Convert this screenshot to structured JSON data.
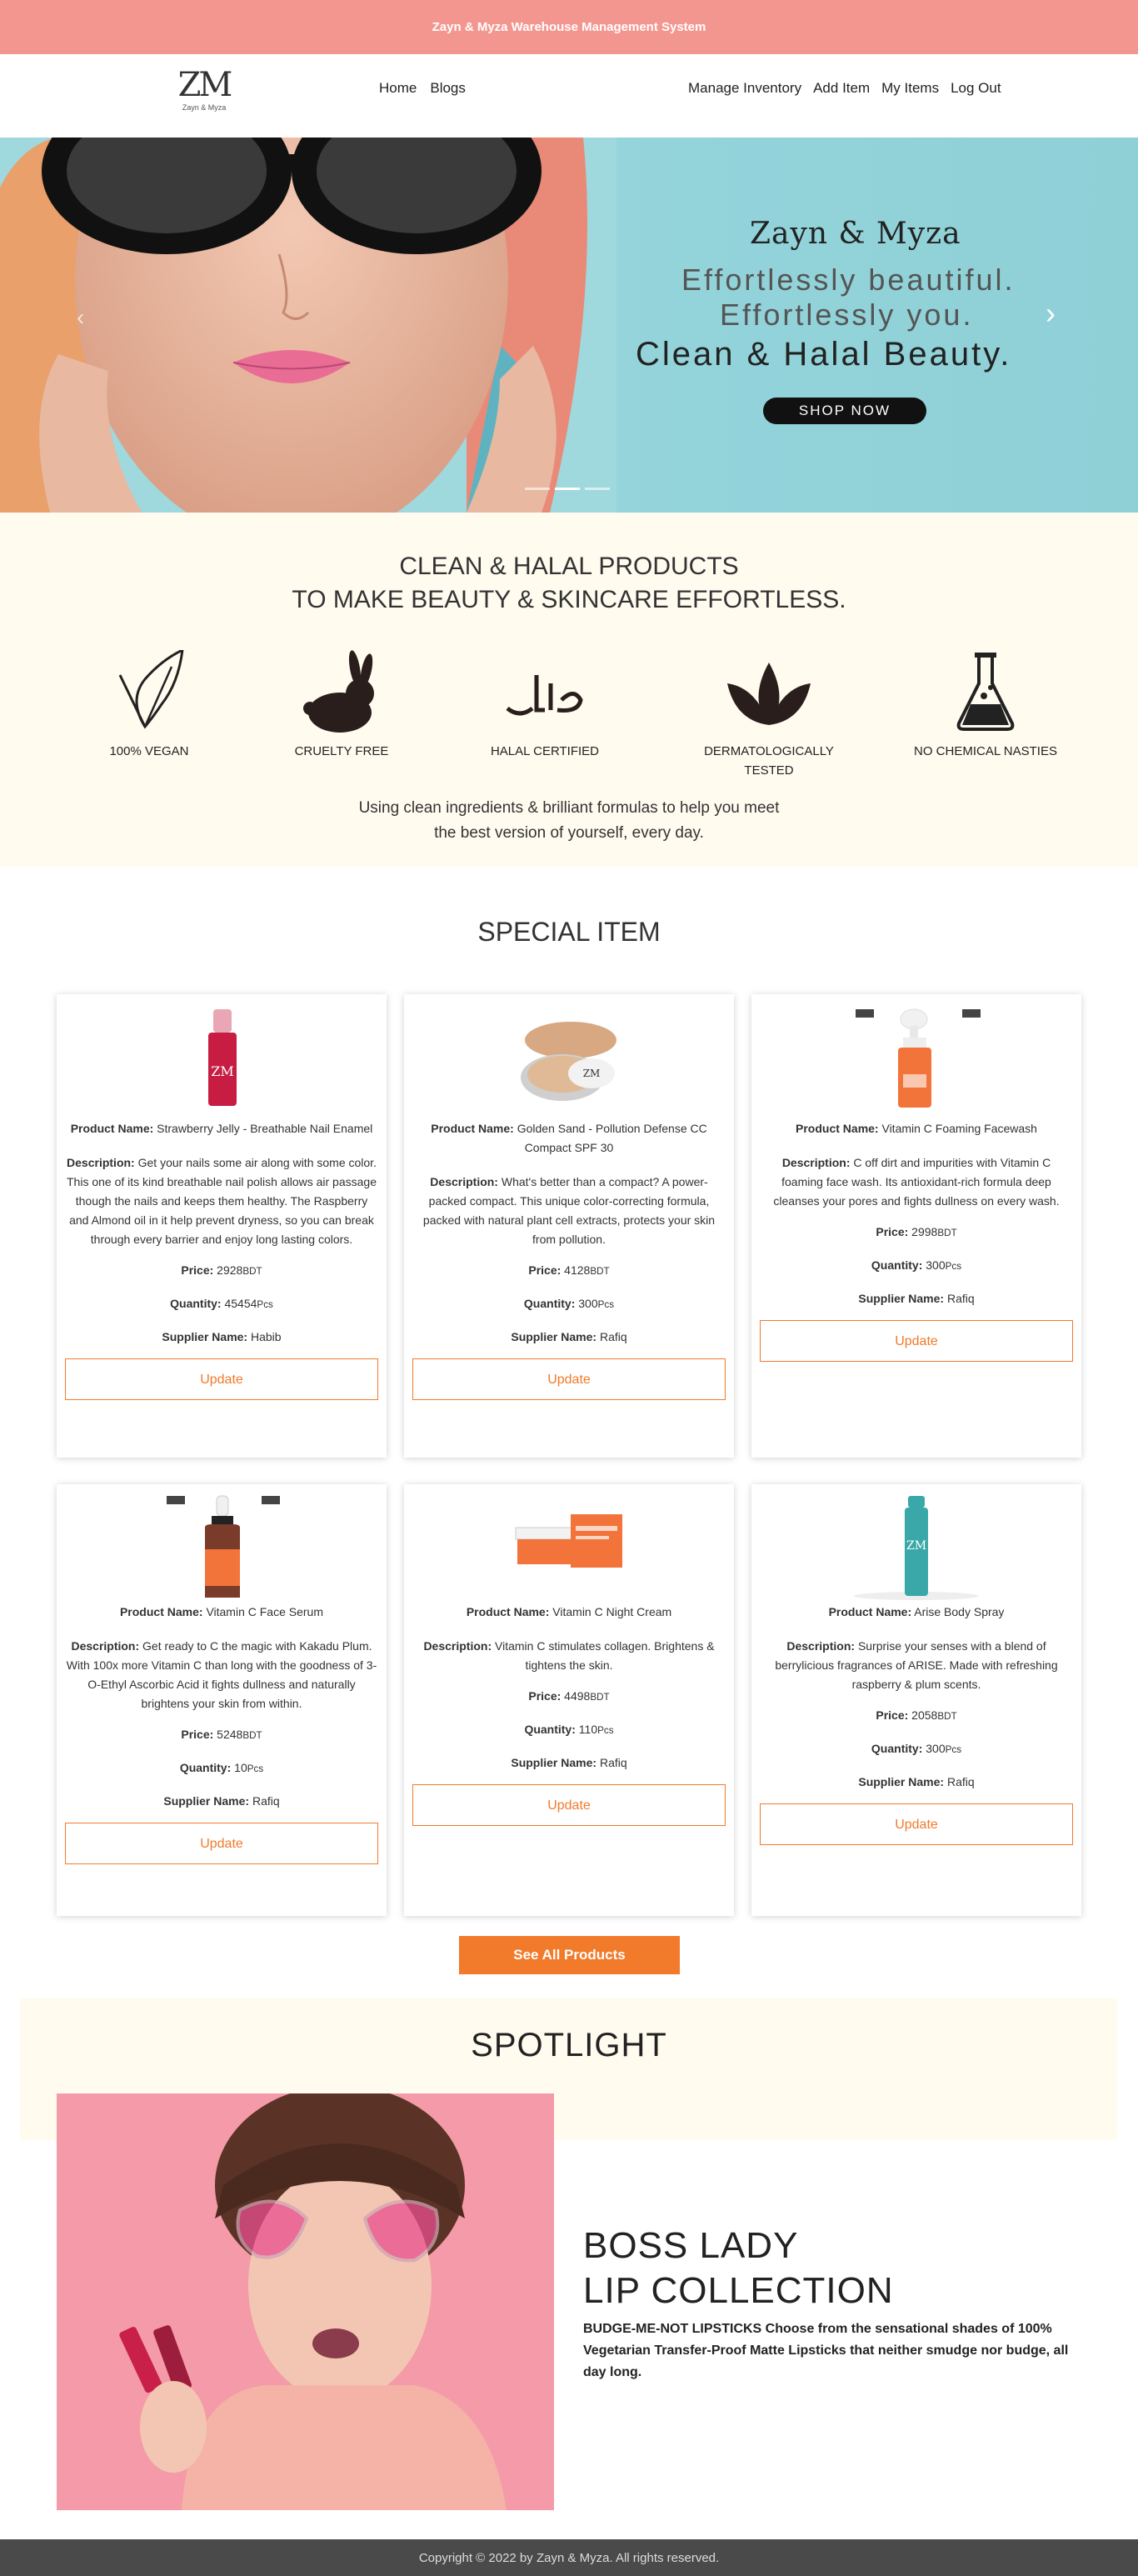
{
  "topbar": {
    "title": "Zayn & Myza Warehouse Management System"
  },
  "logo": {
    "mark": "ZM",
    "sub": "Zayn & Myza"
  },
  "nav": {
    "left": [
      "Home",
      "Blogs"
    ],
    "right": [
      "Manage Inventory",
      "Add Item",
      "My Items",
      "Log Out"
    ]
  },
  "hero": {
    "brand": "Zayn & Myza",
    "line1": "Effortlessly beautiful.",
    "line2": "Effortlessly you.",
    "line3": "Clean & Halal Beauty.",
    "cta": "SHOP NOW",
    "slide_count": 3,
    "active_slide": 2
  },
  "clean": {
    "heading1": "CLEAN & HALAL PRODUCTS",
    "heading2": "TO MAKE BEAUTY & SKINCARE EFFORTLESS.",
    "features": [
      {
        "label": "100% VEGAN",
        "icon": "leaf-icon"
      },
      {
        "label": "CRUELTY FREE",
        "icon": "rabbit-icon"
      },
      {
        "label": "HALAL CERTIFIED",
        "icon": "halal-icon"
      },
      {
        "label": "DERMATOLOGICALLY TESTED",
        "icon": "lotus-icon"
      },
      {
        "label": "NO CHEMICAL NASTIES",
        "icon": "flask-icon"
      }
    ],
    "tagline1": "Using clean ingredients & brilliant formulas to help you meet",
    "tagline2": "the best version of yourself, every day."
  },
  "special": {
    "title": "SPECIAL ITEM"
  },
  "labels": {
    "name": "Product Name:",
    "desc": "Description:",
    "price": "Price:",
    "qty": "Quantity:",
    "supplier": "Supplier Name:",
    "update": "Update",
    "price_unit": "BDT",
    "qty_unit": "Pcs"
  },
  "products": [
    {
      "name": "Strawberry Jelly - Breathable Nail Enamel",
      "description": "Get your nails some air along with some color. This one of its kind breathable nail polish allows air passage though the nails and keeps them healthy. The Raspberry and Almond oil in it help prevent dryness, so you can break through every barrier and enjoy long lasting colors.",
      "price": "2928",
      "quantity": "45454",
      "supplier": "Habib"
    },
    {
      "name": "Golden Sand - Pollution Defense CC Compact SPF 30",
      "description": "What's better than a compact? A power-packed compact. This unique color-correcting formula, packed with natural plant cell extracts, protects your skin from pollution.",
      "price": "4128",
      "quantity": "300",
      "supplier": "Rafiq"
    },
    {
      "name": "Vitamin C Foaming Facewash",
      "description": "C off dirt and impurities with Vitamin C foaming face wash. Its antioxidant-rich formula deep cleanses your pores and fights dullness on every wash.",
      "price": "2998",
      "quantity": "300",
      "supplier": "Rafiq"
    },
    {
      "name": "Vitamin C Face Serum",
      "description": "Get ready to C the magic with Kakadu Plum. With 100x more Vitamin C than long with the goodness of 3-O-Ethyl Ascorbic Acid it fights dullness and naturally brightens your skin from within.",
      "price": "5248",
      "quantity": "10",
      "supplier": "Rafiq"
    },
    {
      "name": "Vitamin C Night Cream",
      "description": "Vitamin C stimulates collagen. Brightens & tightens the skin.",
      "price": "4498",
      "quantity": "110",
      "supplier": "Rafiq"
    },
    {
      "name": "Arise Body Spray",
      "description": "Surprise your senses with a blend of berrylicious fragrances of ARISE. Made with refreshing raspberry & plum scents.",
      "price": "2058",
      "quantity": "300",
      "supplier": "Rafiq"
    }
  ],
  "see_all": "See All Products",
  "spotlight": {
    "title": "SPOTLIGHT",
    "heading1": "BOSS LADY",
    "heading2": "LIP COLLECTION",
    "description": "BUDGE-ME-NOT LIPSTICKS Choose from the sensational shades of 100% Vegetarian Transfer-Proof Matte Lipsticks that neither smudge nor budge, all day long."
  },
  "footer": "Copyright © 2022 by Zayn & Myza. All rights reserved."
}
